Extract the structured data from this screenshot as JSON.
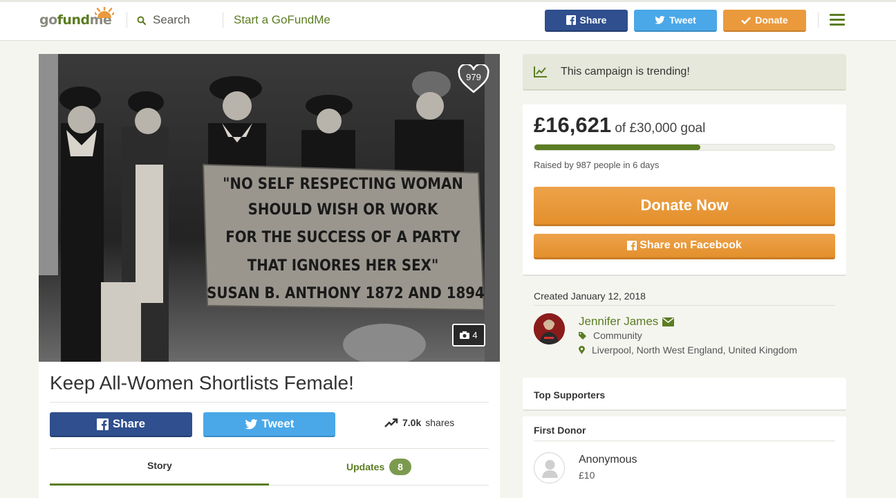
{
  "header": {
    "logo": {
      "go": "go",
      "fund": "fund",
      "me": "me"
    },
    "search_label": "Search",
    "start_label": "Start a GoFundMe",
    "share_label": "Share",
    "tweet_label": "Tweet",
    "donate_label": "Donate"
  },
  "campaign": {
    "hearts": "979",
    "photo_count": "4",
    "title": "Keep All-Women Shortlists Female!",
    "banner_text": [
      "\"NO SELF RESPECTING WOMAN",
      "SHOULD WISH OR WORK",
      "FOR THE SUCCESS OF A PARTY",
      "THAT IGNORES HER SEX\"",
      "SUSAN B. ANTHONY 1872 AND 1894"
    ],
    "share_label": "Share",
    "tweet_label": "Tweet",
    "shares_count": "7.0k",
    "shares_label": "shares",
    "tabs": {
      "story": "Story",
      "updates": "Updates",
      "updates_count": "8"
    }
  },
  "sidebar": {
    "trending_text": "This campaign is trending!",
    "raised_amount": "£16,621",
    "goal_text": "of £30,000 goal",
    "progress_fraction": 0.554,
    "raised_by": "Raised by 987 people in 6 days",
    "donate_now": "Donate Now",
    "share_facebook": "Share on Facebook",
    "created": "Created January 12, 2018",
    "organizer_name": "Jennifer James",
    "category": "Community",
    "location": "Liverpool, North West England, United Kingdom",
    "top_supporters": "Top Supporters",
    "first_donor_heading": "First Donor",
    "first_donor_name": "Anonymous",
    "first_donor_amount": "£10"
  },
  "colors": {
    "brand_green": "#5b7d22",
    "facebook": "#2f4f8e",
    "twitter": "#4aa8e8",
    "donate_orange": "#e9973a"
  },
  "icons": [
    "search-icon",
    "facebook-icon",
    "twitter-icon",
    "check-icon",
    "hamburger-menu-icon",
    "heart-icon",
    "camera-icon",
    "trending-icon",
    "envelope-icon",
    "tag-icon",
    "map-marker-icon",
    "user-icon"
  ]
}
